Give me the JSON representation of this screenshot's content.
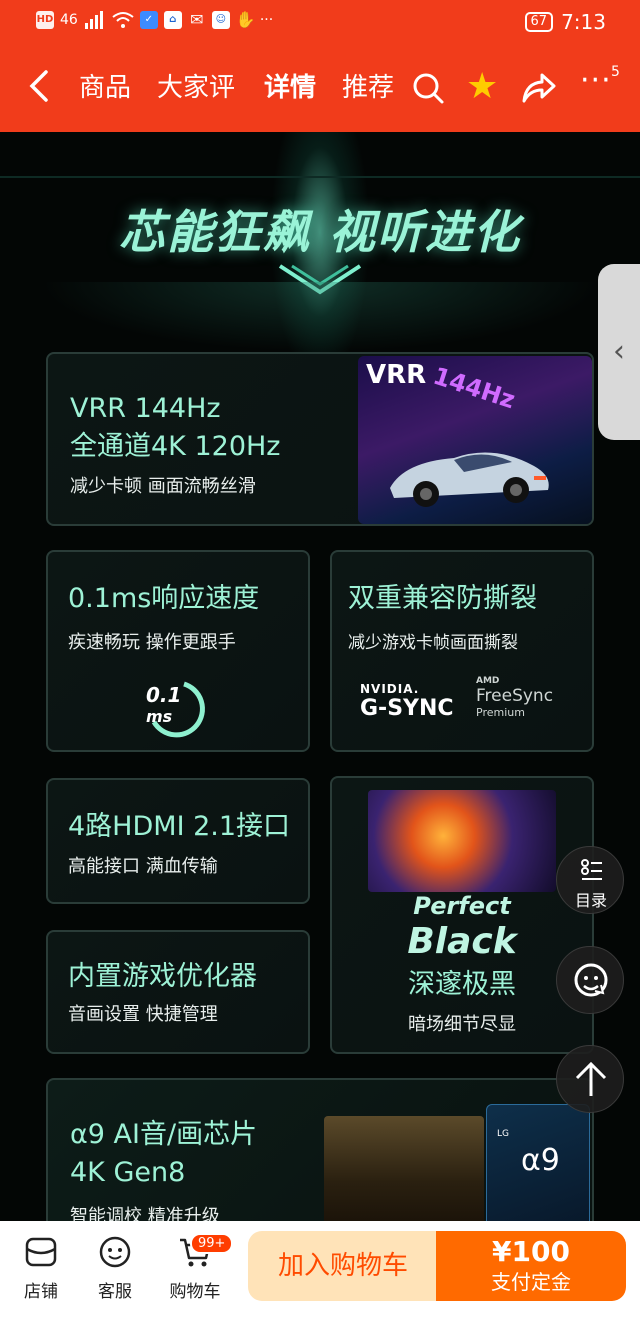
{
  "status_bar": {
    "left_icons": [
      "HD",
      "46",
      "signal",
      "wifi",
      "shield",
      "app",
      "wechat",
      "game",
      "hand"
    ],
    "more": "···",
    "battery": "67",
    "time": "7:13"
  },
  "nav": {
    "back_icon": "chevron-left-icon",
    "tabs": [
      {
        "label": "商品"
      },
      {
        "label": "大家评"
      },
      {
        "label": "详情",
        "active": true
      },
      {
        "label": "推荐"
      }
    ],
    "search_icon": "search-icon",
    "favorite_icon": "star-icon",
    "favorite_color": "#ffcc00",
    "share_icon": "share-icon",
    "more_label": "···",
    "more_badge": "5",
    "bar_color": "#f13c1b"
  },
  "detail": {
    "headline": "芯能狂飙 视听进化",
    "vrr": {
      "title_line1": "VRR 144Hz",
      "title_line2": "全通道4K 120Hz",
      "subtitle": "减少卡顿 画面流畅丝滑",
      "image_label": "VRR",
      "image_label_2": "144Hz"
    },
    "response": {
      "title": "0.1ms响应速度",
      "subtitle": "疾速畅玩 操作更跟手",
      "logo_text_1": "0.1",
      "logo_text_2": "ms"
    },
    "sync": {
      "title": "双重兼容防撕裂",
      "subtitle": "减少游戏卡帧画面撕裂",
      "nvidia_label": "NVIDIA.",
      "gsync_label": "G-SYNC",
      "amd_label": "AMD",
      "freesync_label": "FreeSync",
      "freesync_tier": "Premium"
    },
    "hdmi": {
      "title": "4路HDMI 2.1接口",
      "subtitle": "高能接口 满血传输"
    },
    "black": {
      "logo_line1": "Perfect",
      "logo_line2": "Black",
      "title": "深邃极黑",
      "subtitle": "暗场细节尽显"
    },
    "game": {
      "title": "内置游戏优化器",
      "subtitle": "音画设置 快捷管理"
    },
    "ai": {
      "title_line1": "α9 AI音/画芯片",
      "title_line2": "4K Gen8",
      "subtitle": "智能调校 精准升级",
      "chip_brand": "LG",
      "chip_label": "α9"
    }
  },
  "floating": {
    "side_tab_icon": "chevron-left-icon",
    "toc_label": "目录",
    "toc_icon": "list-icon",
    "chat_icon": "customer-service-icon",
    "top_icon": "arrow-up-icon"
  },
  "bottom_bar": {
    "items": [
      {
        "label": "店铺",
        "icon": "store-icon"
      },
      {
        "label": "客服",
        "icon": "customer-service-icon"
      },
      {
        "label": "购物车",
        "icon": "cart-icon"
      }
    ],
    "cart_badge": "99+",
    "add_to_cart": "加入购物车",
    "deposit_price": "¥100",
    "deposit_label": "支付定金",
    "add_cart_color": "#ffe3b8",
    "pay_color": "#ff6a00"
  }
}
